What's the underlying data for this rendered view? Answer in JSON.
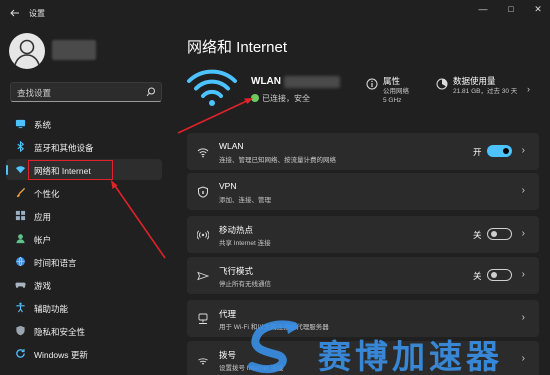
{
  "window": {
    "title": "设置",
    "controls": [
      "—",
      "□",
      "✕"
    ]
  },
  "search": {
    "placeholder": "查找设置"
  },
  "sidebar": {
    "items": [
      {
        "label": "系统",
        "icon": "monitor-icon"
      },
      {
        "label": "蓝牙和其他设备",
        "icon": "bluetooth-icon"
      },
      {
        "label": "网络和 Internet",
        "icon": "network-icon",
        "active": true
      },
      {
        "label": "个性化",
        "icon": "brush-icon"
      },
      {
        "label": "应用",
        "icon": "apps-icon"
      },
      {
        "label": "帐户",
        "icon": "account-icon"
      },
      {
        "label": "时间和语言",
        "icon": "globe-clock-icon"
      },
      {
        "label": "游戏",
        "icon": "gamepad-icon"
      },
      {
        "label": "辅助功能",
        "icon": "accessibility-icon"
      },
      {
        "label": "隐私和安全性",
        "icon": "shield-icon"
      },
      {
        "label": "Windows 更新",
        "icon": "update-icon"
      }
    ]
  },
  "main": {
    "title": "网络和 Internet",
    "connection": {
      "name": "WLAN",
      "status": "已连接，安全"
    },
    "properties": {
      "title": "属性",
      "lines": [
        "公用网络",
        "5 GHz"
      ]
    },
    "data_usage": {
      "title": "数据使用量",
      "lines": [
        "21.81 GB，过去 30 天"
      ]
    },
    "cards": [
      {
        "title": "WLAN",
        "subtitle": "连接、管理已知网络、按流量计费的网络",
        "icon": "wifi-icon",
        "toggle": "开",
        "toggle_on": true
      },
      {
        "title": "VPN",
        "subtitle": "添加、连接、管理",
        "icon": "vpn-shield-icon"
      },
      {
        "title": "移动热点",
        "subtitle": "共享 Internet 连接",
        "icon": "hotspot-icon",
        "toggle": "关",
        "toggle_on": false
      },
      {
        "title": "飞行模式",
        "subtitle": "停止所有无线通信",
        "icon": "airplane-icon",
        "toggle": "关",
        "toggle_on": false
      },
      {
        "title": "代理",
        "subtitle": "用于 Wi-Fi 和以太网连接的代理服务器",
        "icon": "proxy-icon"
      },
      {
        "title": "拨号",
        "subtitle": "设置拨号 Internet 连接",
        "icon": "dialup-icon"
      }
    ]
  },
  "watermark": {
    "text": "赛博加速器"
  },
  "colors": {
    "accent": "#4cc2ff",
    "background": "#202020",
    "card": "#2b2b2b",
    "annotation": "#e0222a",
    "status_ok": "#6ccb5f"
  }
}
